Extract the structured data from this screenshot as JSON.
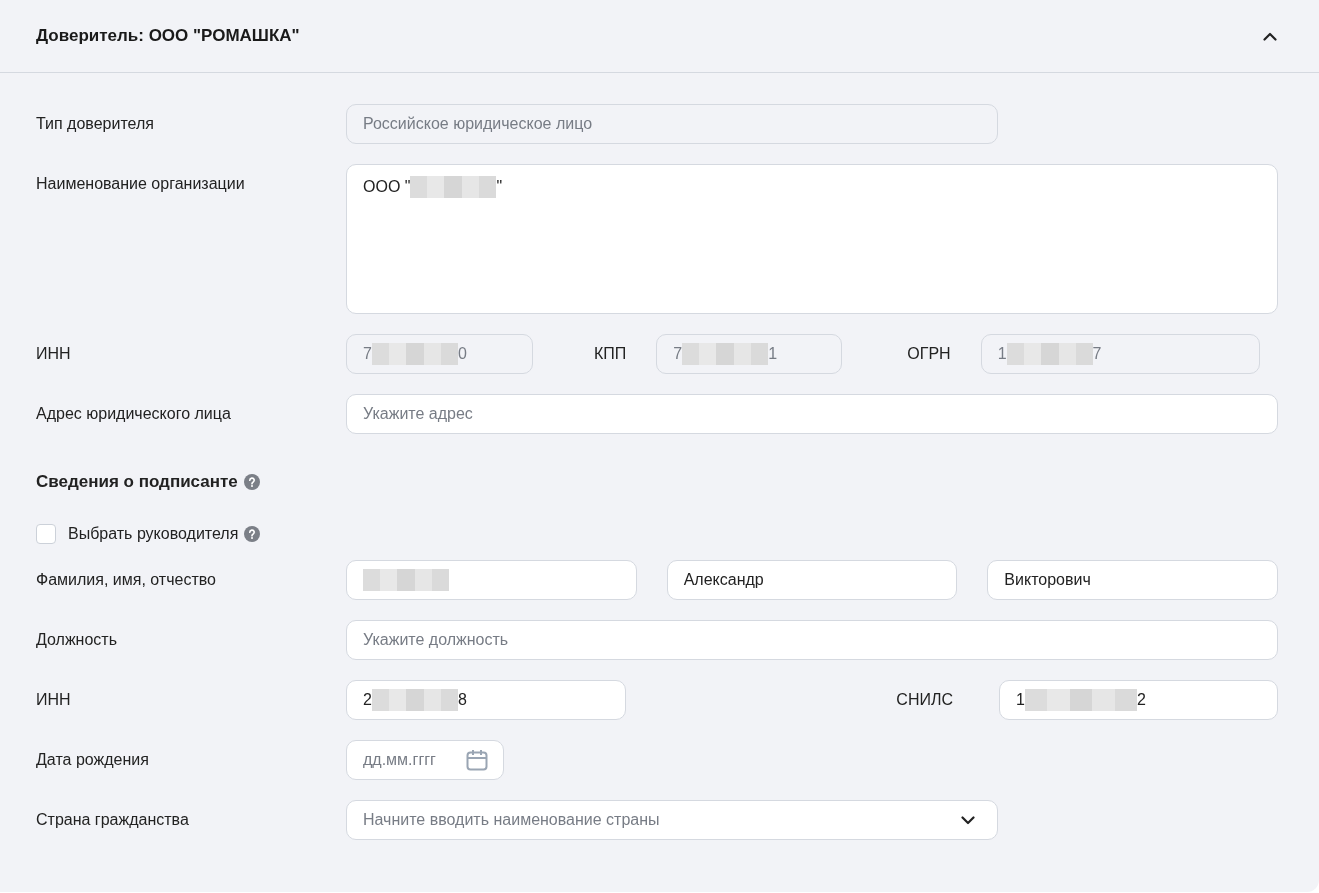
{
  "header": {
    "title": "Доверитель: ООО \"РОМАШКА\"",
    "expanded": true
  },
  "principal_type": {
    "label": "Тип доверителя",
    "value": "Российское юридическое лицо",
    "disabled": true
  },
  "org_name": {
    "label": "Наименование организации",
    "value": "ООО \"",
    "value_end": "\"",
    "redacted": true,
    "disabled": false
  },
  "ids": [
    {
      "label": "ИНН",
      "value": "7",
      "value_end": "0",
      "redacted": true,
      "disabled": true
    },
    {
      "label": "КПП",
      "value": "7",
      "value_end": "1",
      "redacted": true,
      "disabled": true
    },
    {
      "label": "ОГРН",
      "value": "1",
      "value_end": "7",
      "redacted": true,
      "disabled": true
    }
  ],
  "address": {
    "label": "Адрес юридического лица",
    "placeholder": "Укажите адрес"
  },
  "signer": {
    "title": "Сведения о подписанте",
    "choose_head": {
      "label": "Выбрать руководителя",
      "checked": false
    },
    "full_name": {
      "label": "Фамилия, имя, отчество",
      "parts": [
        {
          "redacted": true
        },
        {
          "value": "Александр",
          "redacted": false
        },
        {
          "value": "Викторович",
          "redacted": false
        }
      ]
    },
    "position": {
      "label": "Должность",
      "placeholder": "Укажите должность"
    },
    "inn": {
      "label": "ИНН",
      "value": "2",
      "value_end": "8",
      "redacted": true
    },
    "snils": {
      "label": "СНИЛС",
      "value": "1",
      "value_end": "2",
      "redacted": true
    },
    "birth_date": {
      "label": "Дата рождения",
      "placeholder": "дд.мм.гггг"
    },
    "country": {
      "label": "Страна гражданства",
      "placeholder": "Начните вводить наименование страны"
    }
  }
}
